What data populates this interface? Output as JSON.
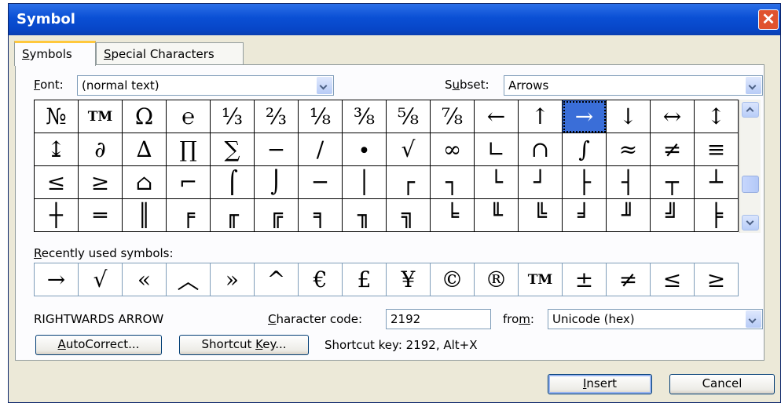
{
  "window": {
    "title": "Symbol"
  },
  "tabs": [
    {
      "pre": "",
      "u": "S",
      "post": "ymbols"
    },
    {
      "pre": "",
      "u": "S",
      "post": "pecial Characters"
    }
  ],
  "font": {
    "label_u": "F",
    "label_rest": "ont:",
    "value": "(normal text)"
  },
  "subset": {
    "label_pre": "S",
    "label_u": "u",
    "label_rest": "bset:",
    "value": "Arrows"
  },
  "symbol_grid": {
    "rows": [
      [
        "№",
        "TM",
        "Ω",
        "℮",
        "⅓",
        "⅔",
        "⅛",
        "⅜",
        "⅝",
        "⅞",
        "←",
        "↑",
        "→",
        "↓",
        "↔",
        "↕"
      ],
      [
        "↨",
        "∂",
        "∆",
        "∏",
        "∑",
        "−",
        "∕",
        "∙",
        "√",
        "∞",
        "∟",
        "∩",
        "∫",
        "≈",
        "≠",
        "≡"
      ],
      [
        "≤",
        "≥",
        "⌂",
        "⌐",
        "⌠",
        "⌡",
        "─",
        "│",
        "┌",
        "┐",
        "└",
        "┘",
        "├",
        "┤",
        "┬",
        "┴"
      ],
      [
        "┼",
        "═",
        "║",
        "╒",
        "╓",
        "╔",
        "╕",
        "╖",
        "╗",
        "╘",
        "╙",
        "╚",
        "╛",
        "╜",
        "╝",
        "╞"
      ]
    ],
    "selected": "→"
  },
  "recent": {
    "label_u": "R",
    "label_rest": "ecently used symbols:",
    "symbols": [
      "→",
      "√",
      "«",
      "︿",
      "»",
      "^",
      "€",
      "£",
      "¥",
      "©",
      "®",
      "TM",
      "±",
      "≠",
      "≤",
      "≥"
    ]
  },
  "char_name": "RIGHTWARDS ARROW",
  "char_code": {
    "label_u": "C",
    "label_rest": "haracter code:",
    "value": "2192"
  },
  "from": {
    "label_pre": "fro",
    "label_u": "m",
    "label_rest": ":",
    "value": "Unicode (hex)"
  },
  "buttons": {
    "autocorrect": {
      "u": "A",
      "rest": "utoCorrect..."
    },
    "shortcut": {
      "pre": "Shortcut ",
      "u": "K",
      "rest": "ey..."
    },
    "insert": {
      "u": "I",
      "rest": "nsert"
    },
    "cancel": "Cancel"
  },
  "shortcut_text": "Shortcut key: 2192, Alt+X"
}
